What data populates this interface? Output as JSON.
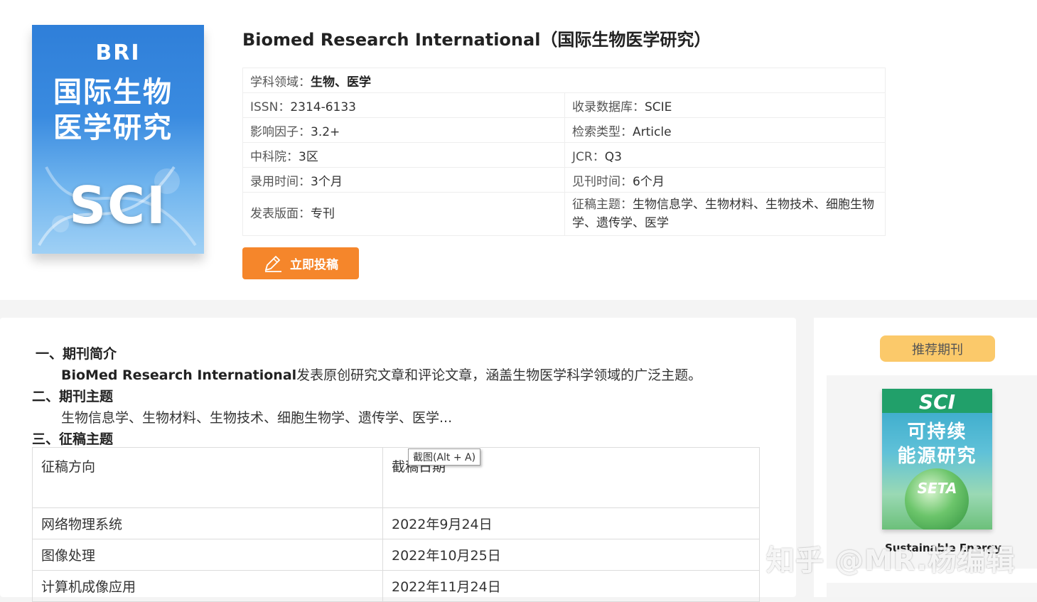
{
  "journal": {
    "title": "Biomed Research International（国际生物医学研究）",
    "cover": {
      "abbr": "BRI",
      "line1": "国际生物",
      "line2": "医学研究",
      "badge": "SCI"
    },
    "info": {
      "field_label": "学科领域：",
      "field_value": "生物、医学",
      "issn_label": "ISSN：",
      "issn_value": "2314-6133",
      "db_label": "收录数据库：",
      "db_value": "SCIE",
      "if_label": "影响因子：",
      "if_value": "3.2+",
      "type_label": "检索类型：",
      "type_value": "Article",
      "cas_label": "中科院：",
      "cas_value": "3区",
      "jcr_label": "JCR：",
      "jcr_value": "Q3",
      "accept_label": "录用时间：",
      "accept_value": "3个月",
      "publish_label": "见刊时间：",
      "publish_value": "6个月",
      "layout_label": "发表版面：",
      "layout_value": "专刊",
      "topics_label": "征稿主题：",
      "topics_value": "生物信息学、生物材料、生物技术、细胞生物学、遗传学、医学"
    },
    "submit_label": "立即投稿"
  },
  "content": {
    "s1_heading": "一、期刊简介",
    "s1_name": "BioMed Research International",
    "s1_text": "发表原创研究文章和评论文章，涵盖生物医学科学领域的广泛主题。",
    "s2_heading": "二、期刊主题",
    "s2_text": "生物信息学、生物材料、生物技术、细胞生物学、遗传学、医学...",
    "s3_heading": "三、征稿主题",
    "table": {
      "col1": "征稿方向",
      "col2": "截稿日期",
      "rows": [
        {
          "topic": "网络物理系统",
          "deadline": "2022年9月24日"
        },
        {
          "topic": "图像处理",
          "deadline": "2022年10月25日"
        },
        {
          "topic": "计算机成像应用",
          "deadline": "2022年11月24日"
        }
      ]
    },
    "tooltip": "截图(Alt + A)"
  },
  "sidebar": {
    "recommend_label": "推荐期刊",
    "card": {
      "badge": "SCI",
      "line1": "可持续",
      "line2": "能源研究",
      "abbr": "SETA",
      "title": "Sustainable Energy"
    }
  },
  "watermark": "知乎 @MR.杨编辑"
}
